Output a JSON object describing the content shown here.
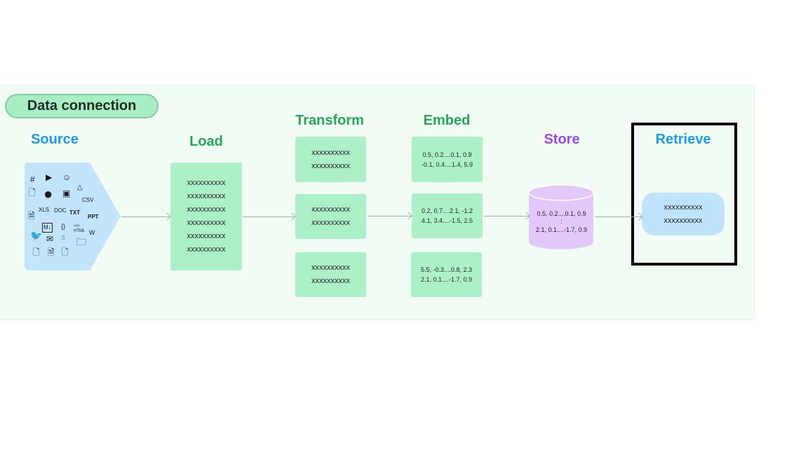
{
  "badge": "Data connection",
  "stages": {
    "source": "Source",
    "load": "Load",
    "transform": "Transform",
    "embed": "Embed",
    "store": "Store",
    "retrieve": "Retrieve"
  },
  "colors": {
    "panel": "#f3fbf5",
    "box": "#abf0c7",
    "source": "#c3e5fb",
    "store": "#e3c9fb",
    "green_label": "#20a957",
    "blue_label": "#1b9cf0",
    "purple_label": "#9a47f4",
    "highlight": "#000000"
  },
  "source_icons": [
    "slack-icon",
    "youtube-icon",
    "discord-icon",
    "file-icon",
    "github-icon",
    "image-icon",
    "google-drive-icon",
    "csv-file-icon",
    "doc-file-icon",
    "xls-file-icon",
    "docx-file-icon",
    "txt-file-icon",
    "ppt-file-icon",
    "markdown-icon",
    "json-file-icon",
    "html-icon",
    "wikipedia-icon",
    "twitter-icon",
    "email-icon",
    "css-file-icon",
    "folder-icon",
    "file-icon",
    "text-file-icon",
    "file-icon"
  ],
  "load": [
    "xxxxxxxxxx",
    "xxxxxxxxxx",
    "xxxxxxxxxx",
    "xxxxxxxxxx",
    "xxxxxxxxxx",
    "xxxxxxxxxx"
  ],
  "transform": [
    [
      "xxxxxxxxxx",
      "xxxxxxxxxx"
    ],
    [
      "xxxxxxxxxx",
      "xxxxxxxxxx"
    ],
    [
      "xxxxxxxxxx",
      "xxxxxxxxxx"
    ]
  ],
  "embed": [
    [
      "0.5, 0.2....0.1, 0.9",
      "-0.1, 0.4....1.4, 5.9"
    ],
    [
      "0.2, 0.7....2.1, -1.2",
      "4.1, 3.4....-1.5, 2.5"
    ],
    [
      "5.5, -0.3....0.8, 2.3",
      "2.1, 0.1....-1.7, 0.9"
    ]
  ],
  "store": [
    "0.5, 0.2....0.1, 0.9",
    ":",
    "2.1, 0.1....-1.7, 0.9"
  ],
  "retrieve": [
    "xxxxxxxxxx",
    "xxxxxxxxxx"
  ]
}
